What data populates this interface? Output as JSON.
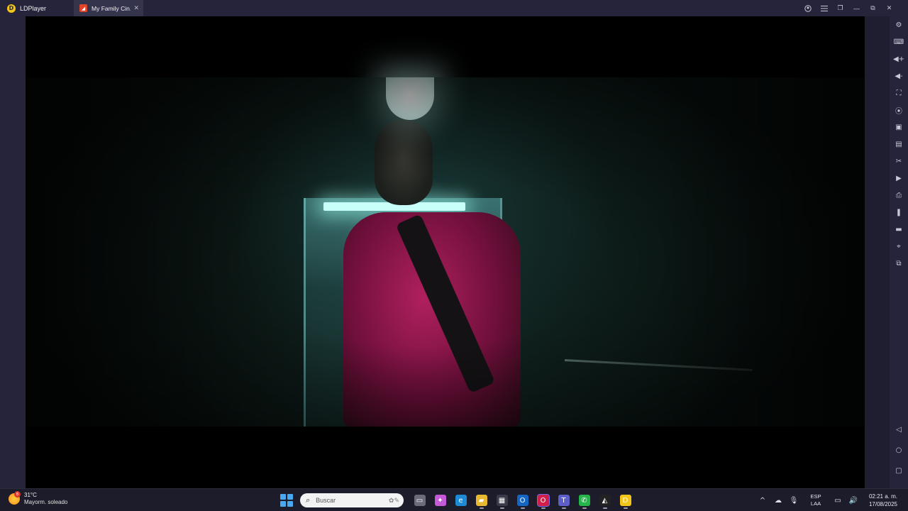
{
  "titlebar": {
    "app_name": "LDPlayer",
    "tab_title": "My Family Cin...",
    "tab_close": "✕",
    "logo_letter": "D",
    "tab_icon_glyph": "◢",
    "controls": {
      "account_icon": "account-icon",
      "menu_icon": "menu-icon",
      "minimize": "—",
      "restore": "❐",
      "maximize": "⧉",
      "close": "✕"
    }
  },
  "right_sidebar": {
    "top_icons": [
      "⚙",
      "⌨",
      "◀+",
      "◀-",
      "⛶",
      "⦿",
      "▣",
      "▤",
      "✂",
      "▶",
      "⎙",
      "❚",
      "▬",
      "⌖",
      "⧉"
    ],
    "top_icon_names": [
      "settings-icon",
      "keyboard-icon",
      "volume-up-icon",
      "volume-down-icon",
      "fullscreen-icon",
      "record-icon",
      "screenshot-icon",
      "apk-install-icon",
      "scissors-icon",
      "video-icon",
      "operation-record-icon",
      "shake-icon",
      "folder-icon",
      "location-icon",
      "multi-instance-icon"
    ],
    "nav_icons": [
      "◁",
      "○",
      "▢"
    ],
    "nav_icon_names": [
      "back-icon",
      "home-icon",
      "recents-icon"
    ]
  },
  "taskbar": {
    "weather": {
      "temp": "31°C",
      "desc": "Mayorm. soleado",
      "badge": "6"
    },
    "search_placeholder": "Buscar",
    "search_icon": "⌕",
    "search_deco": "✿✎",
    "apps": [
      {
        "name": "task-view-icon",
        "glyph": "▭",
        "color": "#6b6b7b",
        "active": false
      },
      {
        "name": "copilot-icon",
        "glyph": "✦",
        "color": "#c45ad8",
        "active": false
      },
      {
        "name": "edge-icon",
        "glyph": "e",
        "color": "#1e8ad6",
        "active": false
      },
      {
        "name": "file-explorer-icon",
        "glyph": "▰",
        "color": "#e8b830",
        "active": false
      },
      {
        "name": "store-icon",
        "glyph": "▦",
        "color": "#3a3a4a",
        "active": false
      },
      {
        "name": "outlook-icon",
        "glyph": "O",
        "color": "#1466c2",
        "active": false
      },
      {
        "name": "opera-icon",
        "glyph": "O",
        "color": "#d0204a",
        "active": true
      },
      {
        "name": "teams-icon",
        "glyph": "T",
        "color": "#5b5fc7",
        "active": false
      },
      {
        "name": "whatsapp-icon",
        "glyph": "✆",
        "color": "#25b54a",
        "active": false
      },
      {
        "name": "capcut-icon",
        "glyph": "◭",
        "color": "#222222",
        "active": false
      },
      {
        "name": "ldplayer-icon",
        "glyph": "D",
        "color": "#f2c518",
        "active": false
      }
    ],
    "tray": {
      "chevron": "^",
      "cloud": "☁",
      "mic": "🎙",
      "lang_top": "ESP",
      "lang_bottom": "LAA",
      "network": "▭",
      "volume": "🔊"
    },
    "clock": {
      "time": "02:21 a. m.",
      "date": "17/08/2025"
    }
  }
}
